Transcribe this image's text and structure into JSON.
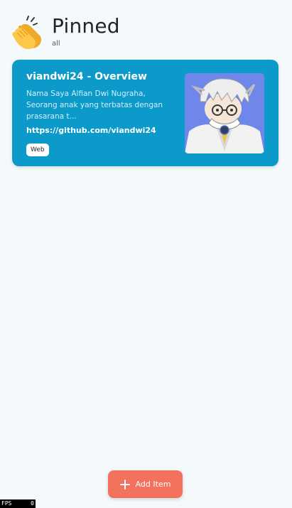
{
  "header": {
    "title": "Pinned",
    "subtitle": "all",
    "icon": "clapping-hands-icon"
  },
  "pinned_items": [
    {
      "title": "viandwi24 - Overview",
      "description": "Nama Saya Alfian Dwi Nugraha, Seorang anak yang terbatas dengan prasarana t...",
      "url": "https://github.com/viandwi24",
      "tag": "Web",
      "thumbnail": "anime-avatar-image"
    }
  ],
  "add_button": {
    "label": "Add Item",
    "icon": "plus-icon"
  },
  "fps": {
    "label": "FPS",
    "value": "0"
  },
  "colors": {
    "background": "#f4fafb",
    "card": "#0b9ac9",
    "add_button": "#f3725e",
    "thumbnail_bg": "#6f86ea"
  }
}
